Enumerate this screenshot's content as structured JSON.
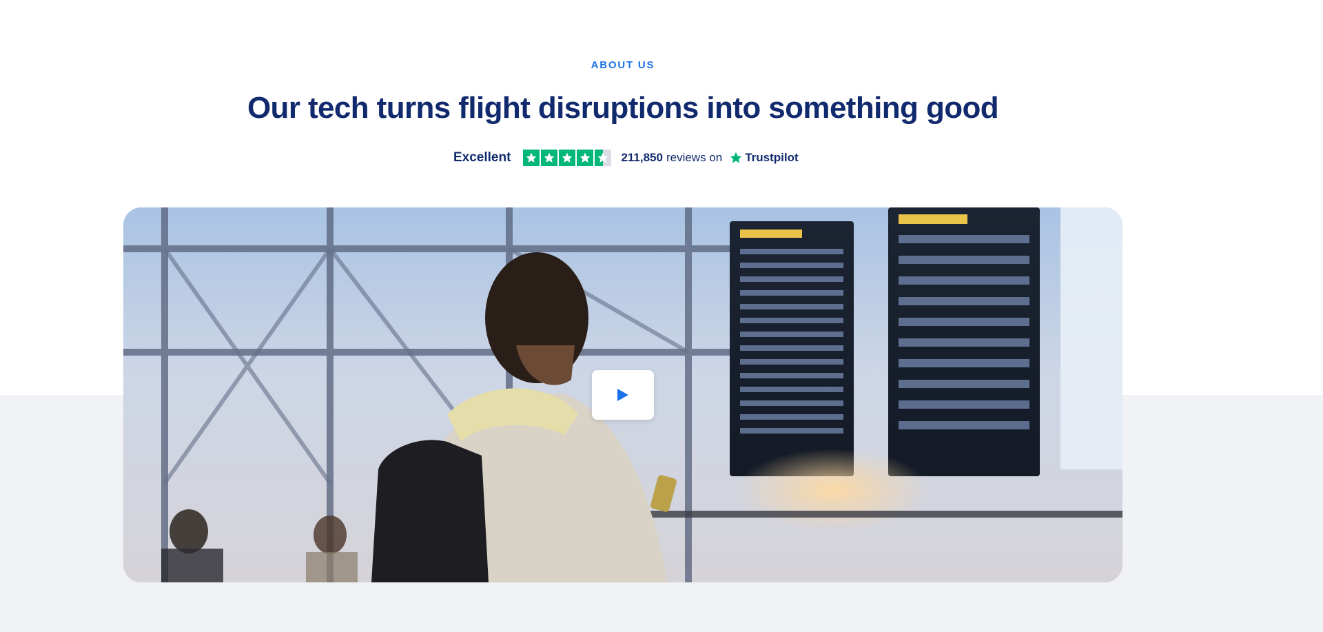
{
  "section": {
    "eyebrow": "ABOUT US",
    "headline": "Our tech turns flight disruptions into something good"
  },
  "trust": {
    "rating_label": "Excellent",
    "rating_stars": 4.5,
    "review_count": "211,850",
    "reviews_text": "reviews on",
    "brand": "Trustpilot"
  },
  "video": {
    "play_icon": "play-icon"
  },
  "colors": {
    "accent": "#1a73e8",
    "headline": "#112a6e",
    "trustpilot_green": "#00b67a",
    "band": "#f0f2f5"
  }
}
